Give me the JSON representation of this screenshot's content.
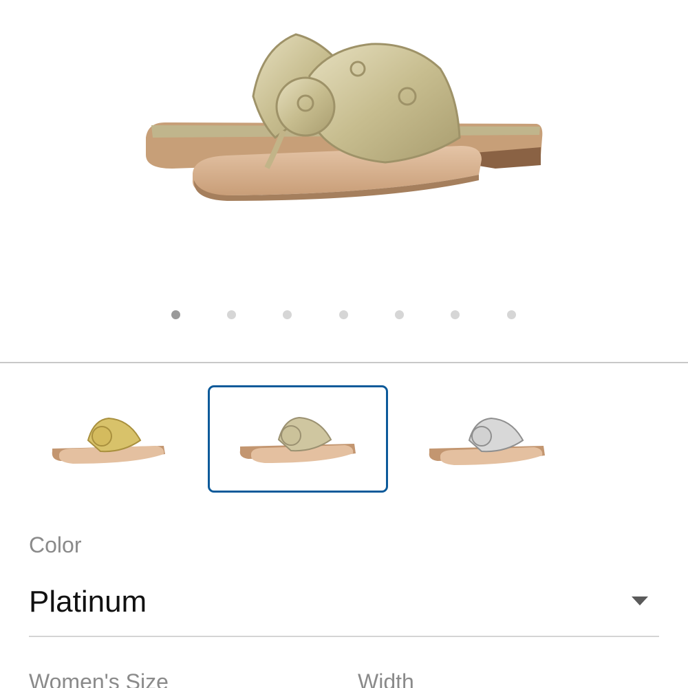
{
  "product": {
    "image_alt": "sandal-photo"
  },
  "carousel": {
    "count": 7,
    "active_index": 0
  },
  "swatches": [
    {
      "name": "Gold",
      "selected": false
    },
    {
      "name": "Platinum",
      "selected": true
    },
    {
      "name": "Silver",
      "selected": false
    }
  ],
  "color": {
    "label": "Color",
    "value": "Platinum"
  },
  "size": {
    "label": "Women's Size"
  },
  "width": {
    "label": "Width"
  },
  "colors": {
    "accent": "#0c5a9a",
    "dot_active": "#9a9a9a",
    "dot_inactive": "#d6d6d6"
  }
}
